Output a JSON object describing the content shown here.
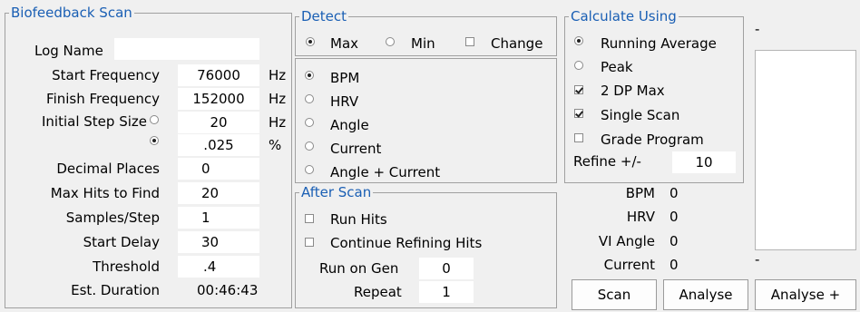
{
  "scan_group": {
    "title": "Biofeedback Scan",
    "log_name_label": "Log Name",
    "log_name_value": "",
    "start_freq_label": "Start Frequency",
    "start_freq_value": "76000",
    "start_freq_unit": "Hz",
    "finish_freq_label": "Finish Frequency",
    "finish_freq_value": "152000",
    "finish_freq_unit": "Hz",
    "step_label": "Initial Step Size",
    "step_hz_value": "20",
    "step_hz_unit": "Hz",
    "step_pct_value": ".025",
    "step_pct_unit": "%",
    "decimal_label": "Decimal Places",
    "decimal_value": "0",
    "maxhits_label": "Max Hits to Find",
    "maxhits_value": "20",
    "samples_label": "Samples/Step",
    "samples_value": "1",
    "delay_label": "Start Delay",
    "delay_value": "30",
    "threshold_label": "Threshold",
    "threshold_value": ".4",
    "duration_label": "Est. Duration",
    "duration_value": "00:46:43"
  },
  "detect_group": {
    "title": "Detect",
    "max_label": "Max",
    "min_label": "Min",
    "change_label": "Change",
    "bpm_label": "BPM",
    "hrv_label": "HRV",
    "angle_label": "Angle",
    "current_label": "Current",
    "angle_current_label": "Angle + Current"
  },
  "after_group": {
    "title": "After Scan",
    "run_hits_label": "Run Hits",
    "continue_label": "Continue Refining Hits",
    "run_gen_label": "Run on Gen",
    "run_gen_value": "0",
    "repeat_label": "Repeat",
    "repeat_value": "1"
  },
  "calc_group": {
    "title": "Calculate Using",
    "running_label": "Running Average",
    "peak_label": "Peak",
    "dp_label": "2 DP Max",
    "single_label": "Single Scan",
    "grade_label": "Grade Program",
    "refine_label": "Refine +/-",
    "refine_value": "10"
  },
  "readouts": {
    "bpm_label": "BPM",
    "bpm_value": "0",
    "hrv_label": "HRV",
    "hrv_value": "0",
    "vi_label": "VI Angle",
    "vi_value": "0",
    "current_label": "Current",
    "current_value": "0"
  },
  "list": {
    "top_dash": "-",
    "bottom_dash": "-"
  },
  "buttons": {
    "scan": "Scan",
    "analyse": "Analyse",
    "analyse_plus": "Analyse +"
  }
}
